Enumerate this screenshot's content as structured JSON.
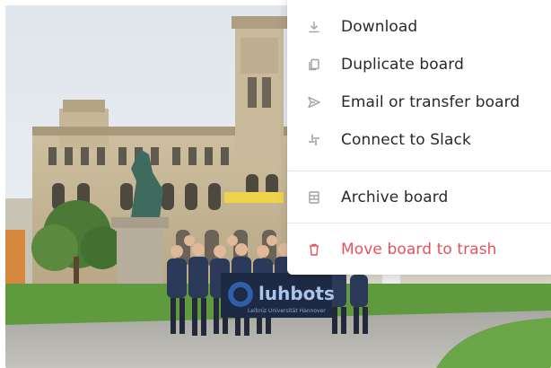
{
  "photo": {
    "description_icon": "group-photo-image",
    "banner_text": "luhbots",
    "banner_subtext": "Leibniz Universität Hannover"
  },
  "menu": {
    "items": [
      {
        "label": "Download",
        "icon": "download-icon"
      },
      {
        "label": "Duplicate board",
        "icon": "duplicate-icon"
      },
      {
        "label": "Email or transfer board",
        "icon": "send-icon"
      },
      {
        "label": "Connect to Slack",
        "icon": "slack-icon"
      },
      {
        "label": "Archive board",
        "icon": "archive-icon"
      },
      {
        "label": "Move board to trash",
        "icon": "trash-icon"
      }
    ],
    "colors": {
      "text": "#26292e",
      "icon": "#9aa0a6",
      "danger": "#e5525c"
    }
  }
}
